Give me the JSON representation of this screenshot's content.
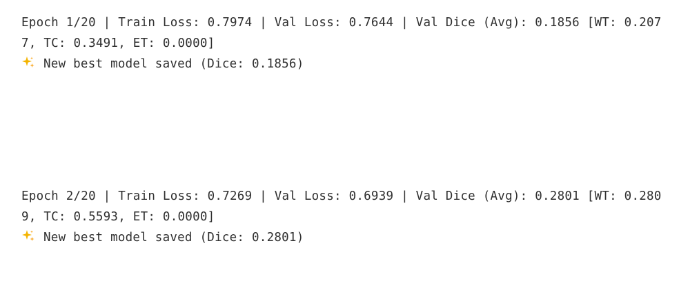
{
  "output": {
    "entries": [
      {
        "line1": "Epoch 1/20 | Train Loss: 0.7974 | Val Loss: 0.7644 | Val Dice (Avg): 0.1856 [WT: 0.207",
        "line2": "7, TC: 0.3491, ET: 0.0000]",
        "best_icon": "sparkle-icon",
        "best_text": "New best model saved (Dice: 0.1856)"
      },
      {
        "line1": "Epoch 2/20 | Train Loss: 0.7269 | Val Loss: 0.6939 | Val Dice (Avg): 0.2801 [WT: 0.280",
        "line2": "9, TC: 0.5593, ET: 0.0000]",
        "best_icon": "sparkle-icon",
        "best_text": "New best model saved (Dice: 0.2801)"
      }
    ]
  },
  "colors": {
    "text": "#2f2f2f",
    "sparkle": "#f4b400",
    "sparkle_accent": "#f9a825",
    "background": "#ffffff"
  }
}
